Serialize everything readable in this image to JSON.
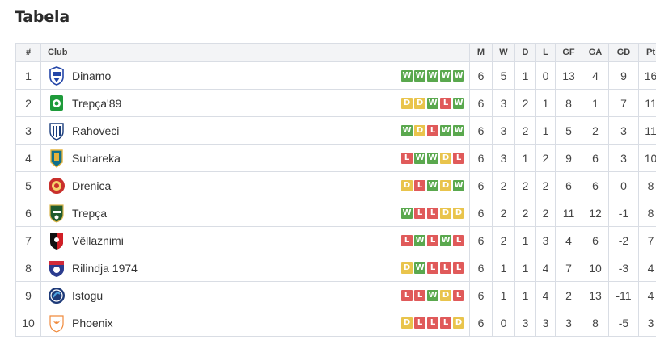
{
  "title": "Tabela",
  "headers": {
    "pos": "#",
    "club": "Club",
    "m": "M",
    "w": "W",
    "d": "D",
    "l": "L",
    "gf": "GF",
    "ga": "GA",
    "gd": "GD",
    "pt": "Pt"
  },
  "colors": {
    "W": "#5aa84e",
    "D": "#e9c44c",
    "L": "#e05a5a"
  },
  "rows": [
    {
      "pos": "1",
      "club": "Dinamo",
      "crest": "dinamo-crest",
      "form": [
        "W",
        "W",
        "W",
        "W",
        "W"
      ],
      "m": "6",
      "w": "5",
      "d": "1",
      "l": "0",
      "gf": "13",
      "ga": "4",
      "gd": "9",
      "pt": "16"
    },
    {
      "pos": "2",
      "club": "Trepça'89",
      "crest": "trepca89-crest",
      "form": [
        "D",
        "D",
        "W",
        "L",
        "W"
      ],
      "m": "6",
      "w": "3",
      "d": "2",
      "l": "1",
      "gf": "8",
      "ga": "1",
      "gd": "7",
      "pt": "11"
    },
    {
      "pos": "3",
      "club": "Rahoveci",
      "crest": "rahoveci-crest",
      "form": [
        "W",
        "D",
        "L",
        "W",
        "W"
      ],
      "m": "6",
      "w": "3",
      "d": "2",
      "l": "1",
      "gf": "5",
      "ga": "2",
      "gd": "3",
      "pt": "11"
    },
    {
      "pos": "4",
      "club": "Suhareka",
      "crest": "suhareka-crest",
      "form": [
        "L",
        "W",
        "W",
        "D",
        "L"
      ],
      "m": "6",
      "w": "3",
      "d": "1",
      "l": "2",
      "gf": "9",
      "ga": "6",
      "gd": "3",
      "pt": "10"
    },
    {
      "pos": "5",
      "club": "Drenica",
      "crest": "drenica-crest",
      "form": [
        "D",
        "L",
        "W",
        "D",
        "W"
      ],
      "m": "6",
      "w": "2",
      "d": "2",
      "l": "2",
      "gf": "6",
      "ga": "6",
      "gd": "0",
      "pt": "8"
    },
    {
      "pos": "6",
      "club": "Trepça",
      "crest": "trepca-crest",
      "form": [
        "W",
        "L",
        "L",
        "D",
        "D"
      ],
      "m": "6",
      "w": "2",
      "d": "2",
      "l": "2",
      "gf": "11",
      "ga": "12",
      "gd": "-1",
      "pt": "8"
    },
    {
      "pos": "7",
      "club": "Vëllaznimi",
      "crest": "vellaznimi-crest",
      "form": [
        "L",
        "W",
        "L",
        "W",
        "L"
      ],
      "m": "6",
      "w": "2",
      "d": "1",
      "l": "3",
      "gf": "4",
      "ga": "6",
      "gd": "-2",
      "pt": "7"
    },
    {
      "pos": "8",
      "club": "Rilindja 1974",
      "crest": "rilindja-crest",
      "form": [
        "D",
        "W",
        "L",
        "L",
        "L"
      ],
      "m": "6",
      "w": "1",
      "d": "1",
      "l": "4",
      "gf": "7",
      "ga": "10",
      "gd": "-3",
      "pt": "4"
    },
    {
      "pos": "9",
      "club": "Istogu",
      "crest": "istogu-crest",
      "form": [
        "L",
        "L",
        "W",
        "D",
        "L"
      ],
      "m": "6",
      "w": "1",
      "d": "1",
      "l": "4",
      "gf": "2",
      "ga": "13",
      "gd": "-11",
      "pt": "4"
    },
    {
      "pos": "10",
      "club": "Phoenix",
      "crest": "phoenix-crest",
      "form": [
        "D",
        "L",
        "L",
        "L",
        "D"
      ],
      "m": "6",
      "w": "0",
      "d": "3",
      "l": "3",
      "gf": "3",
      "ga": "8",
      "gd": "-5",
      "pt": "3"
    }
  ]
}
